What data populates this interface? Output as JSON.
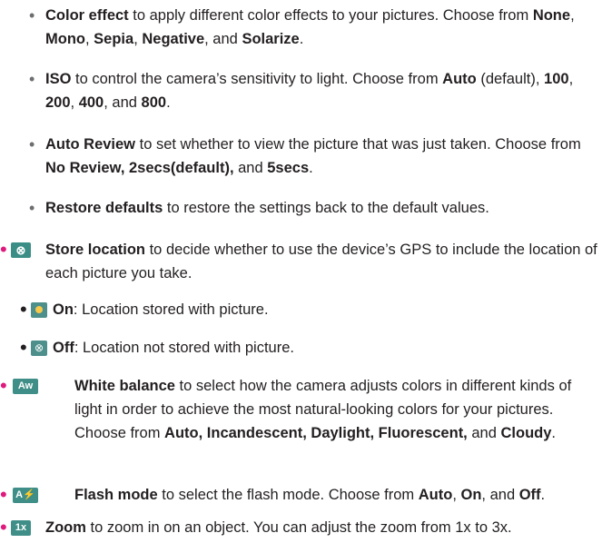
{
  "items": [
    {
      "title": "Color effect",
      "text_before": " to apply different color effects to your pictures. Choose from ",
      "opts": [
        "None",
        "Mono",
        "Sepia",
        "Negative",
        "Solarize"
      ],
      "sep_text": [
        ", ",
        ", ",
        ", ",
        ", and ",
        "."
      ]
    },
    {
      "title": "ISO",
      "text_before": " to control the camera’s sensitivity to light. Choose from ",
      "opts": [
        "Auto",
        "100",
        "200",
        "400",
        "800"
      ],
      "mid_text": " (default), ",
      "sep_text": [
        ", ",
        ", ",
        ", and ",
        "."
      ]
    },
    {
      "title": "Auto Review",
      "text_before": " to set whether to view the picture that was just taken. Choose from ",
      "opts_text": "No Review, 2secs(default),",
      "and_text": " and ",
      "last": "5secs",
      "end": "."
    },
    {
      "title": "Restore defaults",
      "text": " to restore the settings back to the default values."
    },
    {
      "title": "Store location",
      "text": " to decide whether to use the device’s GPS to include the location of each picture you take.",
      "sub": [
        {
          "title": "On",
          "text": ": Location stored with picture."
        },
        {
          "title": "Off",
          "text": ": Location not stored with picture."
        }
      ]
    },
    {
      "title": "White balance",
      "text": " to select how the camera adjusts colors in different kinds of light in order to achieve the most natural-looking colors for your pictures. Choose from ",
      "opts_text": "Auto, Incandescent, Daylight, Fluorescent,",
      "and_text": " and ",
      "last": "Cloudy",
      "end": ".",
      "icon_label": "Aw"
    },
    {
      "title": "Flash mode",
      "text": " to select the flash mode. Choose from ",
      "opts": [
        "Auto",
        "On",
        "Off"
      ],
      "sep_text": [
        ", ",
        ", and ",
        "."
      ],
      "icon_label": "A⚡"
    },
    {
      "title": "Zoom",
      "text": " to zoom in on an object. You can adjust the zoom from 1x to 3x.",
      "icon_label": "1x"
    }
  ],
  "bullet_gray": "•",
  "bullet_pink": "•"
}
